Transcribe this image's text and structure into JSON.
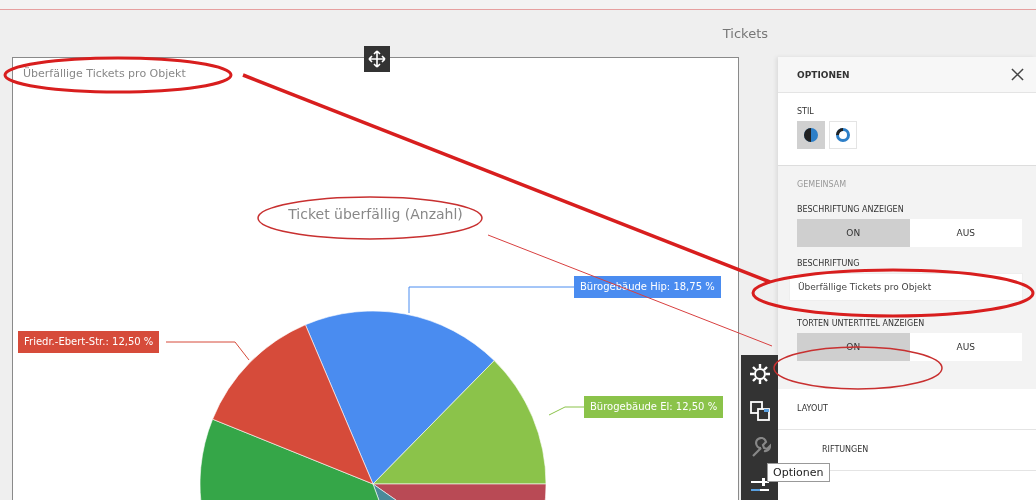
{
  "header": {
    "title": "Tickets"
  },
  "chart_card": {
    "title": "Überfällige Tickets pro Objekt",
    "subtitle": "Ticket überfällig (Anzahl)",
    "slice_labels": [
      {
        "text": "Bürogebäude Hip: 18,75 %",
        "color": "#4a8cf0"
      },
      {
        "text": "Friedr.-Ebert-Str.: 12,50 %",
        "color": "#d64b3a"
      },
      {
        "text": "Bürogebäude El: 12,50 %",
        "color": "#8bc34a"
      }
    ]
  },
  "toolbar": {
    "tooltip": "Optionen"
  },
  "options_panel": {
    "title": "OPTIONEN",
    "style": {
      "label": "STIL",
      "options": [
        {
          "kind": "pie",
          "selected": true
        },
        {
          "kind": "donut",
          "selected": false
        }
      ]
    },
    "common": {
      "heading": "GEMEINSAM",
      "fields": [
        {
          "kind": "toggle",
          "label": "BESCHRIFTUNG ANZEIGEN",
          "options": [
            {
              "label": "ON",
              "selected": true
            },
            {
              "label": "AUS",
              "selected": false
            }
          ]
        },
        {
          "kind": "text",
          "label": "BESCHRIFTUNG",
          "value": "Überfällige Tickets pro Objekt"
        },
        {
          "kind": "toggle",
          "label": "TORTEN UNTERTITEL ANZEIGEN",
          "options": [
            {
              "label": "ON",
              "selected": true
            },
            {
              "label": "AUS",
              "selected": false
            }
          ]
        }
      ]
    },
    "sections": [
      {
        "label": "LAYOUT"
      },
      {
        "label": "RIFTUNGEN"
      }
    ]
  }
}
